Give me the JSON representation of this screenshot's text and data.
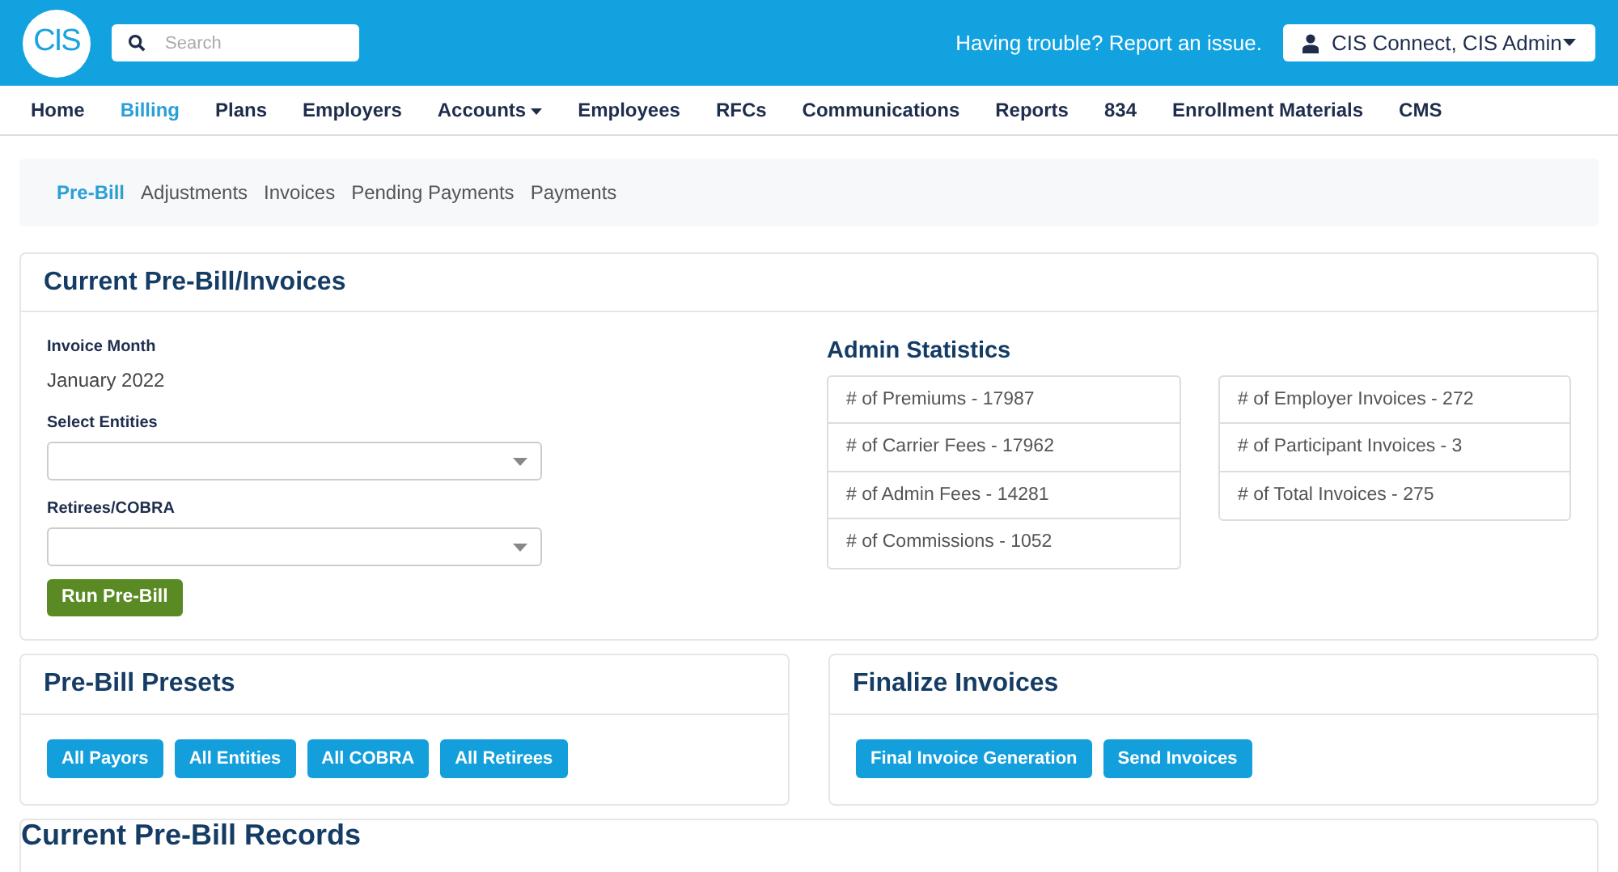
{
  "header": {
    "logo": "CIS",
    "search": {
      "placeholder": "Search"
    },
    "help_link": "Having trouble? Report an issue.",
    "user_menu": "CIS Connect, CIS Admin"
  },
  "nav": [
    {
      "label": "Home",
      "selected": false,
      "dropdown": false
    },
    {
      "label": "Billing",
      "selected": true,
      "dropdown": false
    },
    {
      "label": "Plans",
      "selected": false,
      "dropdown": false
    },
    {
      "label": "Employers",
      "selected": false,
      "dropdown": false
    },
    {
      "label": "Accounts",
      "selected": false,
      "dropdown": true
    },
    {
      "label": "Employees",
      "selected": false,
      "dropdown": false
    },
    {
      "label": "RFCs",
      "selected": false,
      "dropdown": false
    },
    {
      "label": "Communications",
      "selected": false,
      "dropdown": false
    },
    {
      "label": "Reports",
      "selected": false,
      "dropdown": false
    },
    {
      "label": "834",
      "selected": false,
      "dropdown": false
    },
    {
      "label": "Enrollment Materials",
      "selected": false,
      "dropdown": false
    },
    {
      "label": "CMS",
      "selected": false,
      "dropdown": false
    }
  ],
  "subnav": [
    {
      "label": "Pre-Bill",
      "selected": true
    },
    {
      "label": "Adjustments",
      "selected": false
    },
    {
      "label": "Invoices",
      "selected": false
    },
    {
      "label": "Pending Payments",
      "selected": false
    },
    {
      "label": "Payments",
      "selected": false
    }
  ],
  "main_card": {
    "title": "Current Pre-Bill/Invoices",
    "invoice_month_label": "Invoice Month",
    "invoice_month": "January 2022",
    "select_entities_label": "Select Entities",
    "retirees_label": "Retirees/COBRA",
    "run_button": "Run Pre-Bill",
    "stats_title": "Admin Statistics",
    "stats_left": [
      "# of Premiums - 17987",
      "# of Carrier Fees - 17962",
      "# of Admin Fees - 14281",
      "# of Commissions - 1052"
    ],
    "stats_right": [
      "# of Employer Invoices - 272",
      "# of Participant Invoices - 3",
      "# of Total Invoices - 275"
    ]
  },
  "presets_card": {
    "title": "Pre-Bill Presets",
    "buttons": [
      "All Payors",
      "All Entities",
      "All COBRA",
      "All Retirees"
    ]
  },
  "finalize_card": {
    "title": "Finalize Invoices",
    "buttons": [
      "Final Invoice Generation",
      "Send Invoices"
    ]
  },
  "records_card": {
    "title": "Current Pre-Bill Records"
  }
}
